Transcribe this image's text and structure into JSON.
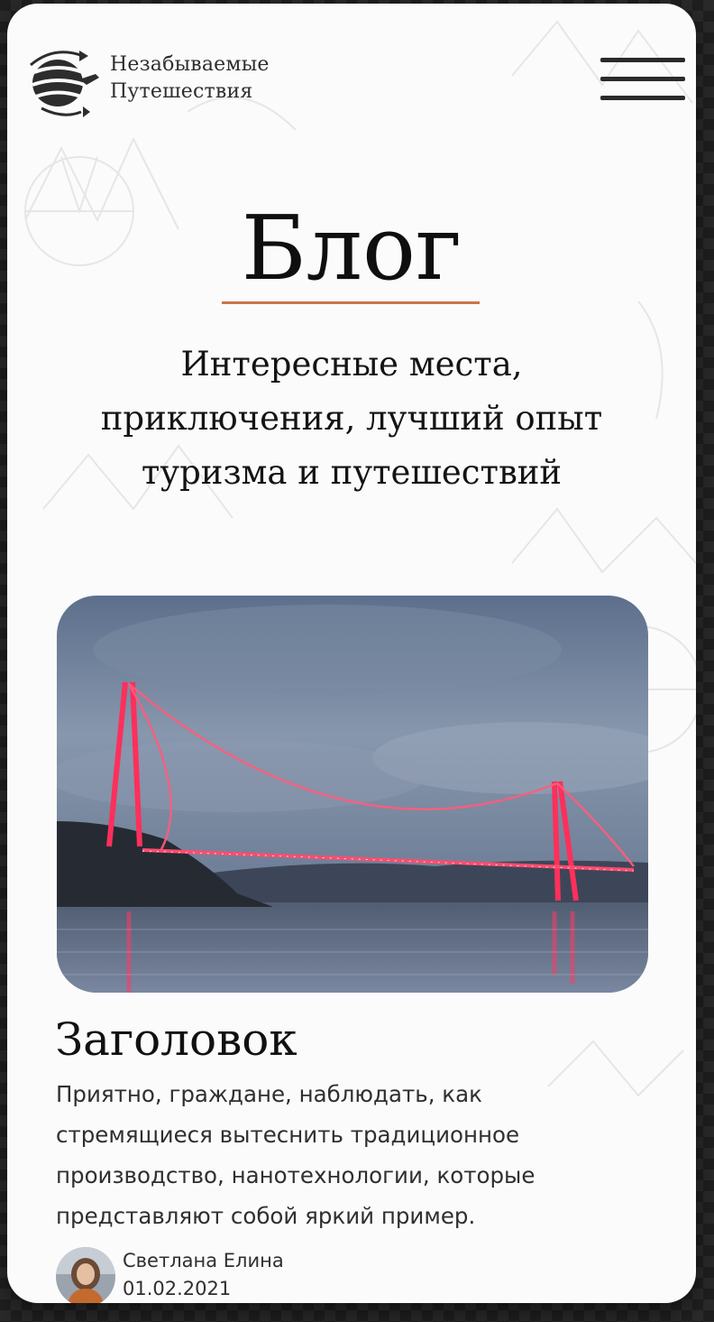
{
  "brand": {
    "line1": "Незабываемые",
    "line2": "Путешествия"
  },
  "menu": {
    "icon": "hamburger-menu-icon"
  },
  "page": {
    "title": "Блог",
    "subtitle_lines": [
      "Интересные места,",
      "приключения, лучший опыт",
      "туризма и путешествий"
    ]
  },
  "post": {
    "image_description": "bridge-photo",
    "heading": "Заголовок",
    "text_lines": [
      "Приятно, граждане, наблюдать, как",
      "стремящиеся вытеснить традиционное",
      "производство, нанотехнологии, которые",
      "представляют собой яркий пример."
    ],
    "author": {
      "name": "Светлана Елина",
      "date": "01.02.2021"
    }
  },
  "colors": {
    "accent": "#c8764a",
    "text": "#111111",
    "background": "#fbfbfb"
  }
}
